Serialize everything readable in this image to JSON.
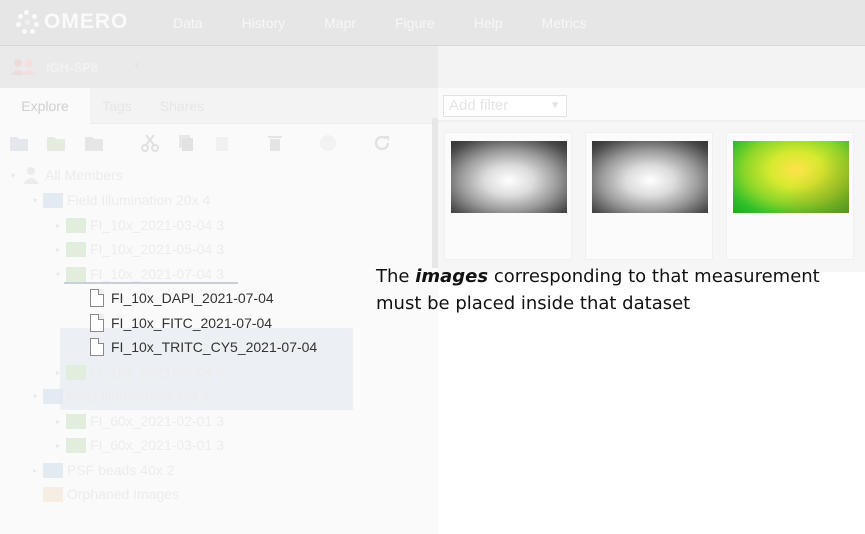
{
  "app": {
    "logo": "OMERO",
    "nav": [
      "Data",
      "History",
      "Mapr",
      "Figure",
      "Help",
      "Metrics"
    ]
  },
  "user": {
    "group_name": "IGH-SP8"
  },
  "left_tabs": [
    "Explore",
    "Tags",
    "Shares"
  ],
  "toolbar_icons": [
    "new-project-icon",
    "new-dataset-icon",
    "new-screen-icon",
    "cut-icon",
    "copy-icon",
    "paste-icon",
    "delete-icon",
    "chgrp-icon",
    "refresh-icon"
  ],
  "tree": {
    "root": "All Members",
    "projects": [
      {
        "name": "Field Illumination 20x",
        "count": "4",
        "datasets": [
          {
            "name": "FI_10x_2021-03-04",
            "count": "3"
          },
          {
            "name": "FI_10x_2021-05-04",
            "count": "3"
          },
          {
            "name": "FI_10x_2021-07-04",
            "count": "3",
            "images": [
              "FI_10x_DAPI_2021-07-04",
              "FI_10x_FITC_2021-07-04",
              "FI_10x_TRITC_CY5_2021-07-04"
            ]
          },
          {
            "name": "FI_10x_2021-09-04",
            "count": "3"
          }
        ]
      },
      {
        "name": "Field Illumination 40x",
        "count": "2",
        "datasets": [
          {
            "name": "FI_60x_2021-02-01",
            "count": "3"
          },
          {
            "name": "FI_60x_2021-03-01",
            "count": "3"
          }
        ]
      },
      {
        "name": "PSF beads 40x",
        "count": "2"
      }
    ],
    "orphaned": "Orphaned Images"
  },
  "filter": {
    "placeholder": "Add filter"
  },
  "colors": {
    "annotation_text": "#111111",
    "selection_bg": "#eceff3"
  },
  "annotation": {
    "prefix": "The ",
    "emphasis": "images",
    "line1_rest": " corresponding to that measurement",
    "line2": "must be placed inside that dataset"
  }
}
